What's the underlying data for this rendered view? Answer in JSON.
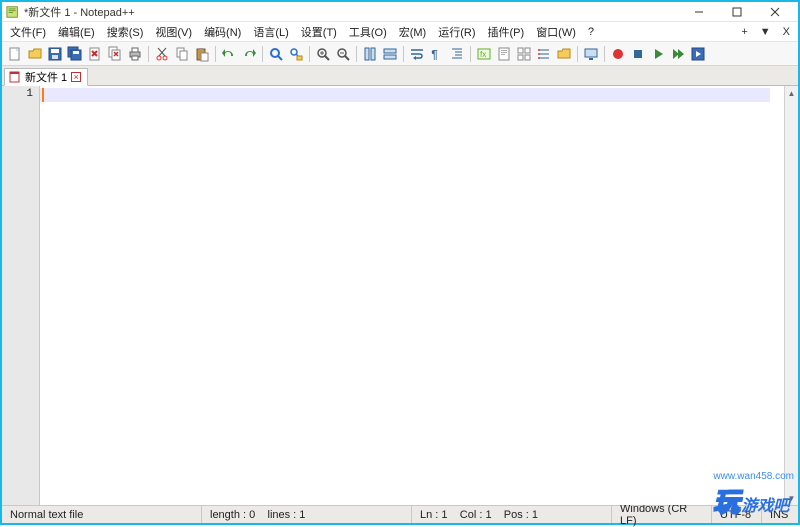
{
  "window": {
    "title": "*新文件 1 - Notepad++"
  },
  "menu": {
    "items": [
      "文件(F)",
      "编辑(E)",
      "搜索(S)",
      "视图(V)",
      "编码(N)",
      "语言(L)",
      "设置(T)",
      "工具(O)",
      "宏(M)",
      "运行(R)",
      "插件(P)",
      "窗口(W)"
    ],
    "help": "?"
  },
  "menu_right": {
    "plus": "+",
    "down": "▼",
    "x": "X"
  },
  "toolbar_icons": [
    "new-file-icon",
    "open-file-icon",
    "save-icon",
    "save-all-icon",
    "close-icon",
    "close-all-icon",
    "print-icon",
    "sep",
    "cut-icon",
    "copy-icon",
    "paste-icon",
    "sep",
    "undo-icon",
    "redo-icon",
    "sep",
    "find-icon",
    "replace-icon",
    "sep",
    "zoom-in-icon",
    "zoom-out-icon",
    "sep",
    "sync-v-icon",
    "sync-h-icon",
    "sep",
    "word-wrap-icon",
    "show-all-chars-icon",
    "indent-guide-icon",
    "sep",
    "language-icon",
    "doc-map-icon",
    "doc-list-icon",
    "function-list-icon",
    "folder-icon",
    "sep",
    "monitor-icon",
    "sep",
    "record-macro-icon",
    "stop-macro-icon",
    "play-macro-icon",
    "play-multi-icon",
    "save-macro-icon"
  ],
  "tabs": [
    {
      "label": "新文件 1",
      "modified": true
    }
  ],
  "editor": {
    "line_numbers": [
      "1"
    ]
  },
  "status": {
    "filetype": "Normal text file",
    "length": "length : 0",
    "lines": "lines : 1",
    "ln": "Ln : 1",
    "col": "Col : 1",
    "pos": "Pos : 1",
    "eol": "Windows (CR LF)",
    "encoding": "UTF-8",
    "mode": "INS"
  },
  "watermark": {
    "url": "www.wan458.com",
    "logo_cn": "游戏吧"
  }
}
